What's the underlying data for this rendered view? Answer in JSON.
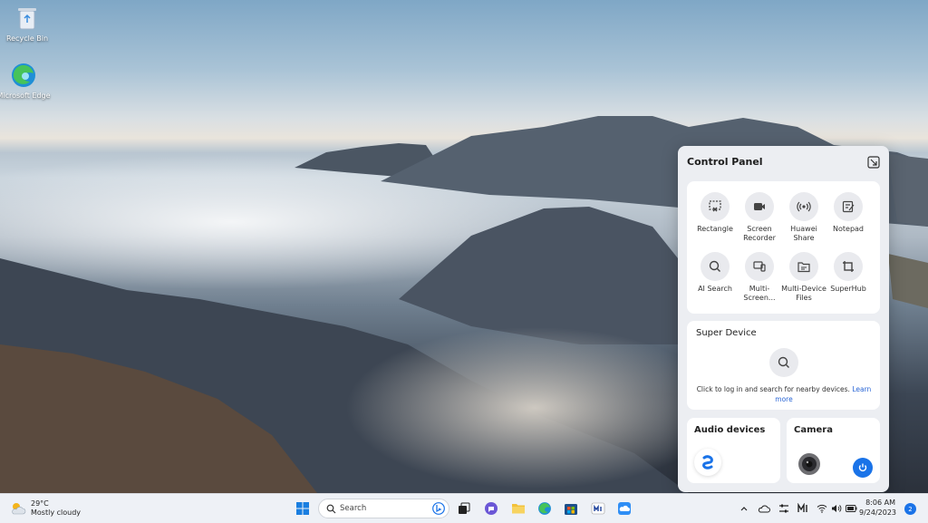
{
  "desktop": {
    "icons": [
      {
        "label": "Recycle Bin"
      },
      {
        "label": "Microsoft Edge"
      }
    ]
  },
  "control_panel": {
    "title": "Control Panel",
    "tools": [
      {
        "label": "Rectangle",
        "icon": "rectangle-screenshot-icon"
      },
      {
        "label": "Screen Recorder",
        "icon": "video-camera-icon"
      },
      {
        "label": "Huawei Share",
        "icon": "broadcast-icon"
      },
      {
        "label": "Notepad",
        "icon": "notepad-icon"
      },
      {
        "label": "AI Search",
        "icon": "search-icon"
      },
      {
        "label": "Multi-Screen...",
        "icon": "multi-screen-icon"
      },
      {
        "label": "Multi-Device Files",
        "icon": "folder-files-icon"
      },
      {
        "label": "SuperHub",
        "icon": "superhub-icon"
      }
    ],
    "super_device": {
      "title": "Super Device",
      "text": "Click to log in and search for nearby devices.",
      "link": "Learn more"
    },
    "audio_devices": {
      "title": "Audio devices"
    },
    "camera": {
      "title": "Camera"
    }
  },
  "taskbar": {
    "weather": {
      "temp": "29°C",
      "condition": "Mostly cloudy"
    },
    "search_placeholder": "Search",
    "clock": {
      "time": "8:06 AM",
      "date": "9/24/2023"
    },
    "notifications_count": "2"
  },
  "colors": {
    "accent": "#1a73e8",
    "panel_bg": "#eceef2",
    "taskbar_bg": "#eef1f6"
  }
}
